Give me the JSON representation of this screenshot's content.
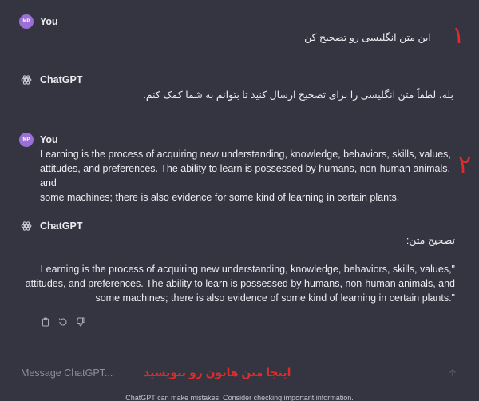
{
  "messages": [
    {
      "author": "You",
      "avatar_initials": "MP",
      "text": "این متن انگلیسی رو تصحیح کن"
    },
    {
      "author": "ChatGPT",
      "text": "بله، لطفاً متن انگلیسی را برای تصحیح ارسال کنید تا بتوانم به شما کمک کنم."
    },
    {
      "author": "You",
      "avatar_initials": "MP",
      "lines": [
        "Learning is the process of acquiring new understanding, knowledge, behaviors, skills, values,",
        "attitudes, and preferences. The ability to learn is possessed by humans, non-human animals, and",
        "some machines; there is also evidence for some kind of learning in certain plants."
      ]
    },
    {
      "author": "ChatGPT",
      "heading": "تصحیح متن:",
      "lines": [
        "Learning is the process of acquiring new understanding, knowledge, behaviors, skills, values,\"",
        "attitudes, and preferences. The ability to learn is possessed by humans, non-human animals, and",
        "some machines; there is also evidence of some kind of learning in certain plants.\""
      ]
    }
  ],
  "annotations": {
    "one": "۱",
    "two": "۲",
    "input_hint": "اینجا متن هاتون رو بنویسید"
  },
  "actions": {
    "icons": [
      "copy-icon",
      "regenerate-icon",
      "thumbs-down-icon"
    ]
  },
  "composer": {
    "placeholder": "Message ChatGPT..."
  },
  "footer": {
    "disclaimer": "ChatGPT can make mistakes. Consider checking important information."
  },
  "colors": {
    "background": "#343541",
    "text": "#ececf1",
    "avatar": "#9b6fd6",
    "annotation": "#e02b2b"
  }
}
